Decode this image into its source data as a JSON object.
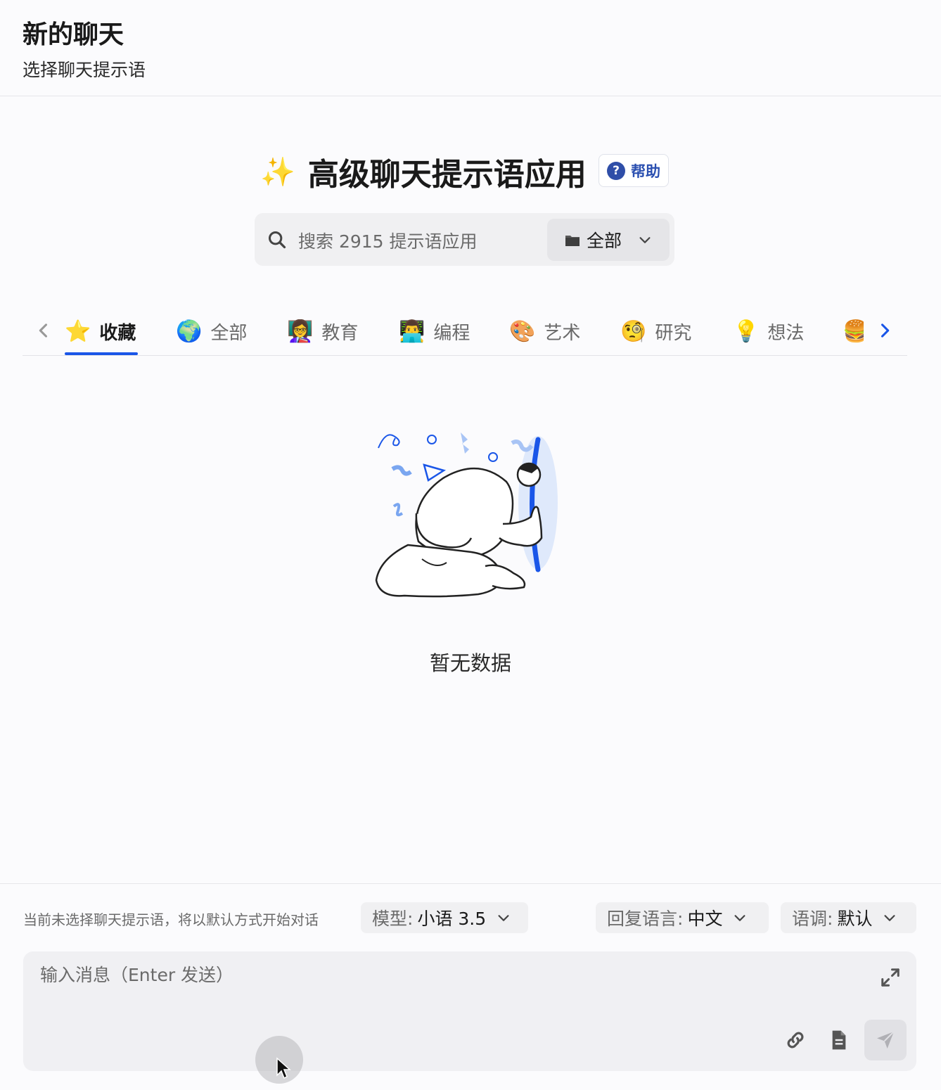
{
  "header": {
    "title": "新的聊天",
    "subtitle": "选择聊天提示语"
  },
  "hero": {
    "sparkle_icon": "sparkles-icon",
    "title": "高级聊天提示语应用",
    "help_label": "帮助"
  },
  "search": {
    "placeholder": "搜索 2915 提示语应用",
    "category_label": "全部"
  },
  "tabs": [
    {
      "emoji": "⭐",
      "label": "收藏",
      "active": true
    },
    {
      "emoji": "🌍",
      "label": "全部"
    },
    {
      "emoji": "👩‍🏫",
      "label": "教育"
    },
    {
      "emoji": "👨‍💻",
      "label": "编程"
    },
    {
      "emoji": "🎨",
      "label": "艺术"
    },
    {
      "emoji": "🧐",
      "label": "研究"
    },
    {
      "emoji": "💡",
      "label": "想法"
    },
    {
      "emoji": "🍔",
      "label": ""
    }
  ],
  "empty": {
    "text": "暂无数据"
  },
  "footer": {
    "hint": "当前未选择聊天提示语，将以默认方式开始对话",
    "model": {
      "label": "模型:",
      "value": "小语 3.5"
    },
    "reply_language": {
      "label": "回复语言:",
      "value": "中文"
    },
    "tone": {
      "label": "语调:",
      "value": "默认"
    }
  },
  "composer": {
    "placeholder": "输入消息（Enter 发送）"
  },
  "colors": {
    "accent": "#1a56e8",
    "help": "#2f4ea8"
  }
}
